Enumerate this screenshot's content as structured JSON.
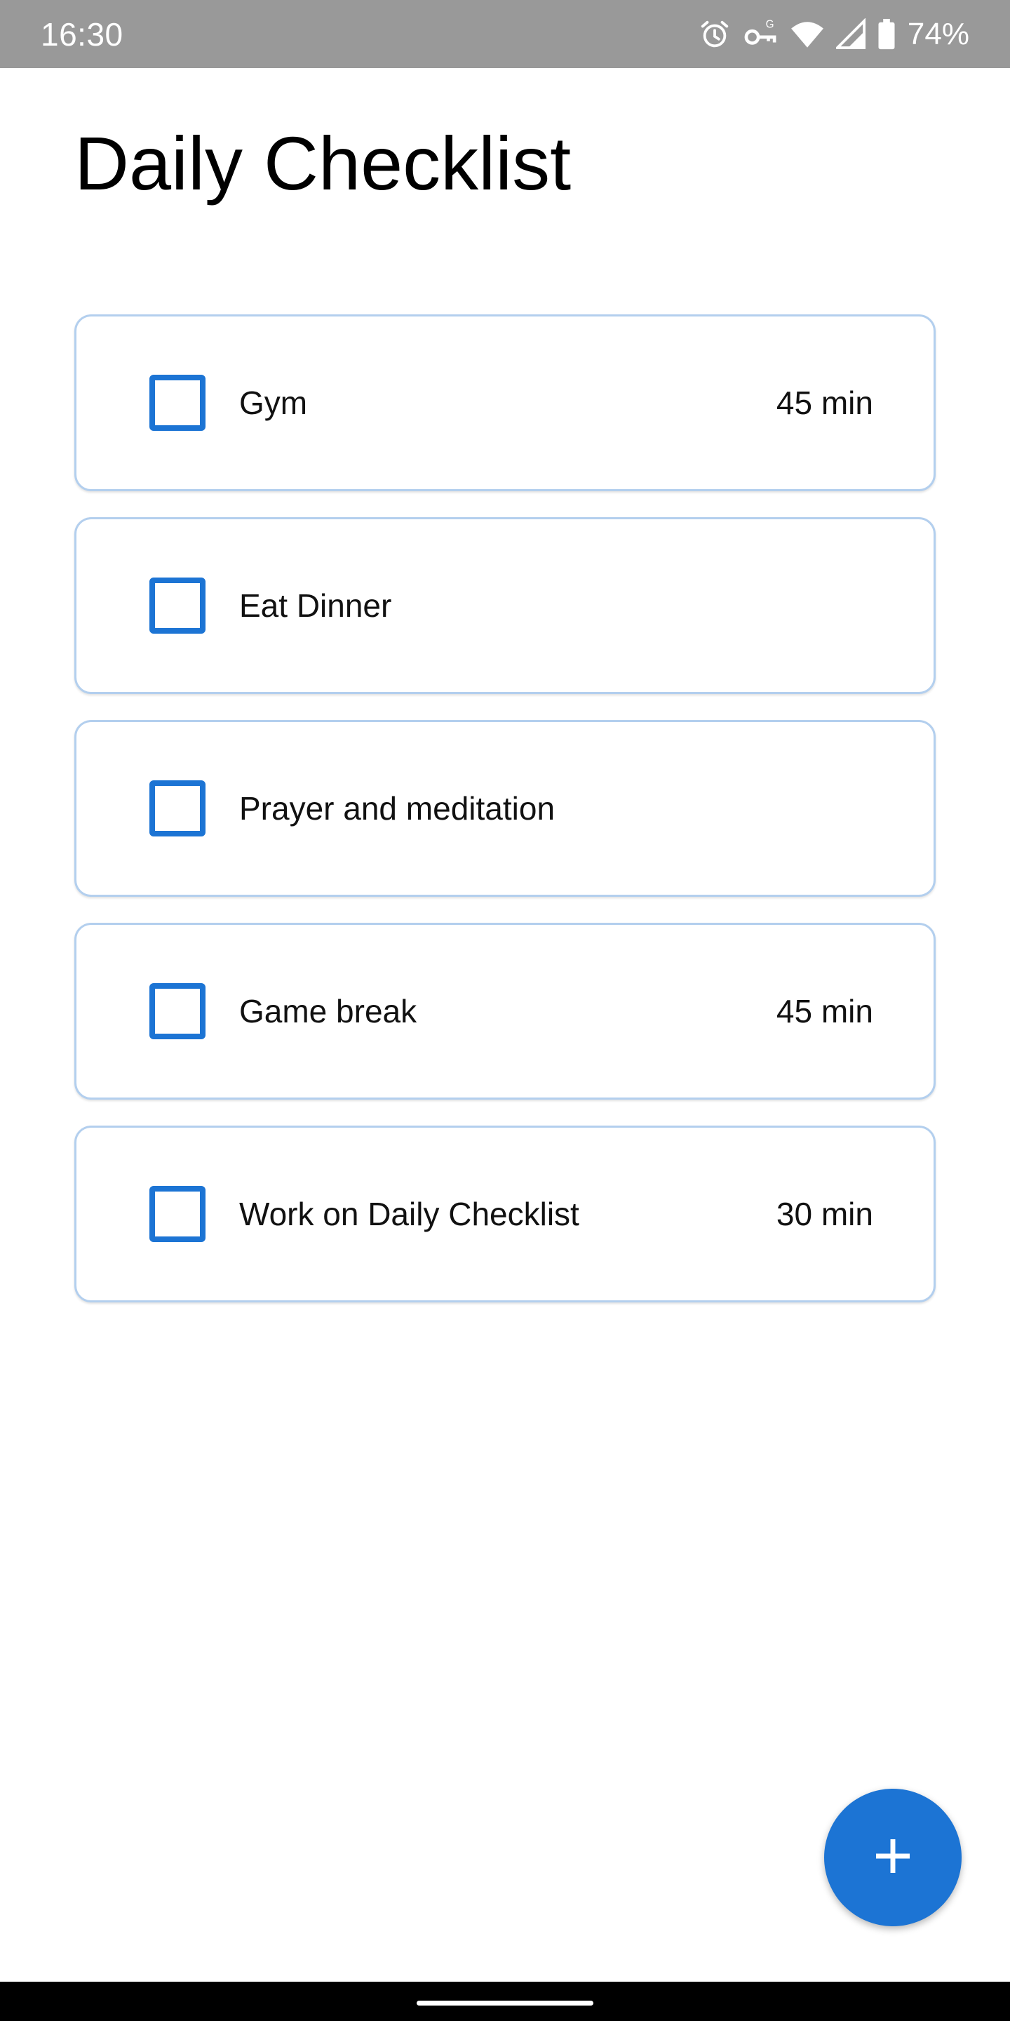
{
  "status_bar": {
    "time": "16:30",
    "battery_percent": "74%",
    "icons": [
      "alarm-icon",
      "vpn-key-icon",
      "wifi-icon",
      "signal-icon",
      "battery-icon"
    ]
  },
  "title": "Daily Checklist",
  "tasks": [
    {
      "name": "Gym",
      "duration": "45 min",
      "checked": false
    },
    {
      "name": "Eat Dinner",
      "duration": "",
      "checked": false
    },
    {
      "name": "Prayer and meditation",
      "duration": "",
      "checked": false
    },
    {
      "name": "Game break",
      "duration": "45 min",
      "checked": false
    },
    {
      "name": "Work on Daily Checklist",
      "duration": "30 min",
      "checked": false
    }
  ],
  "fab": {
    "icon": "plus-icon"
  },
  "colors": {
    "accent": "#1c74d4",
    "card_border": "#b3cfee",
    "status_bar": "#999999"
  }
}
